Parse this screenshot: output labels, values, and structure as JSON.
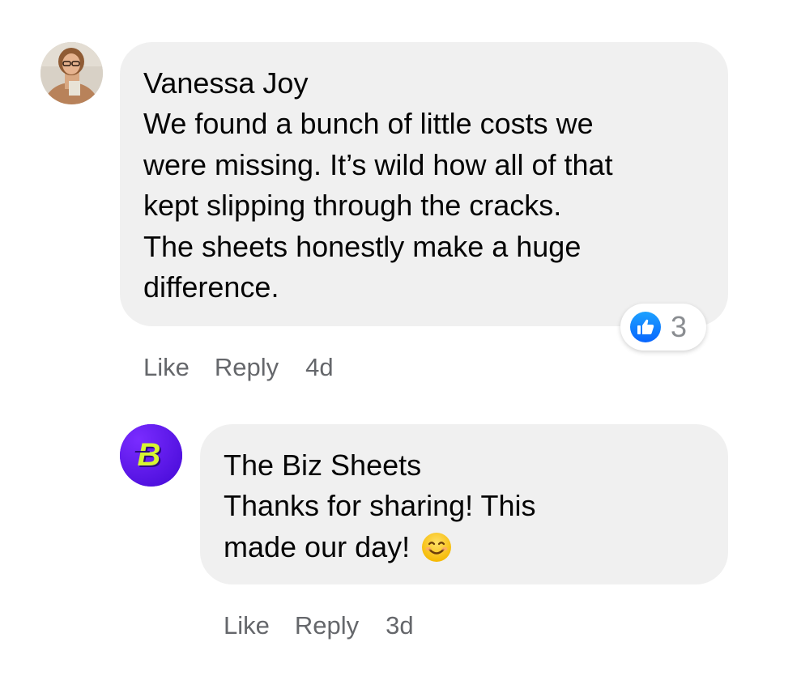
{
  "comment": {
    "author": "Vanessa Joy",
    "avatar_icon": "user-portrait-avatar",
    "lines": [
      "We found a bunch of little costs we",
      "were missing. It’s wild how all of that",
      "kept slipping through the cracks.",
      "The sheets honestly make a huge",
      "difference."
    ],
    "reaction": {
      "icon": "thumbs-up-icon",
      "count": "3",
      "color": "#1877f2"
    },
    "actions": {
      "like": "Like",
      "reply": "Reply",
      "time": "4d"
    }
  },
  "reply": {
    "author": "The Biz Sheets",
    "avatar_icon": "biz-sheets-logo",
    "avatar_color": "#5b16e6",
    "logo_color": "#d7f531",
    "lines": [
      "Thanks for sharing! This",
      "made our day!"
    ],
    "emoji": "smiling-face-emoji",
    "actions": {
      "like": "Like",
      "reply": "Reply",
      "time": "3d"
    }
  },
  "colors": {
    "bubble": "#f0f0f0",
    "text": "#050505",
    "secondary_text": "#65676b"
  }
}
